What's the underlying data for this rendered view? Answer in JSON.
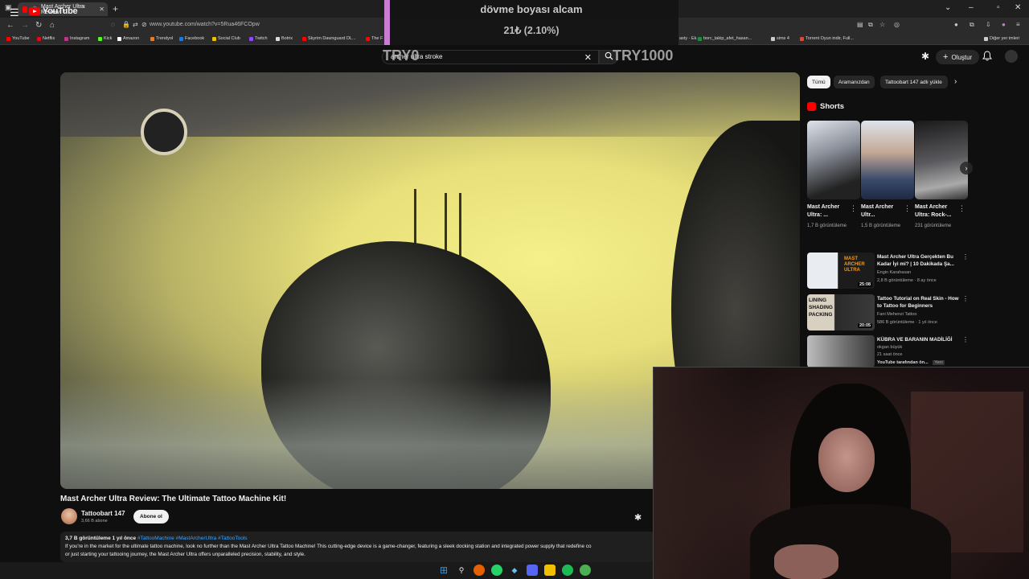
{
  "browser": {
    "tab_title": "Mast Archer Ultra Review: T",
    "url": "www.youtube.com/watch?v=5Rua46FCOpw",
    "bookmarks": [
      "YouTube",
      "Netflix",
      "Instagram",
      "Kick",
      "Amazon",
      "Trendyol",
      "Facebook",
      "Social Club",
      "Twitch",
      "Botrix",
      "Skyrim Dawnguard DL...",
      "The F"
    ],
    "bookmarks_right": [
      "asty - Ek...",
      "borc_takip_afet_hasan...",
      "sims 4",
      "Torrent Oyun indir, Full..."
    ],
    "other_bookmarks": "Diğer yer imleri"
  },
  "stream_overlay": {
    "title": "dövme boyası alcam",
    "progress": "21₺ (2.10%)",
    "goal_start": "TRY0",
    "goal_end": "TRY1000"
  },
  "youtube": {
    "logo": "YouTube",
    "logo_country": "TR",
    "search_value": "archer ultra stroke",
    "create_label": "Oluştur",
    "video_title": "Mast Archer Ultra Review: The Ultimate Tattoo Machine Kit!",
    "channel_name": "Tattoobart 147",
    "channel_subs": "3,66 B abone",
    "subscribe_label": "Abone ol",
    "desc_views": "3,7 B görüntüleme  1 yıl önce",
    "desc_tags": "#TattooMachine #MastArcherUltra #TattooTools",
    "desc_line1": "If you're in the market for the ultimate tattoo machine, look no further than the Mast Archer Ultra Tattoo Machine! This cutting-edge device is a game-changer, featuring a sleek docking station and integrated power supply that redefine co",
    "desc_line2": "or just starting your tattooing journey, the Mast Archer Ultra offers unparalleled precision, stability, and style."
  },
  "sidebar": {
    "chips": [
      "Tümü",
      "Aramanızdan",
      "Tattoobart 147 adlı yükle"
    ],
    "shorts_label": "Shorts",
    "shorts": [
      {
        "title": "Mast Archer Ultra: ...",
        "views": "1,7 B görüntüleme"
      },
      {
        "title": "Mast Archer Ultr...",
        "views": "1,5 B görüntüleme"
      },
      {
        "title": "Mast Archer Ultra: Rock-...",
        "views": "231 görüntüleme"
      }
    ],
    "recommended": [
      {
        "title": "Mast Archer Ultra Gerçekten Bu Kadar İyi mi? | 10 Dakikada Şa...",
        "channel": "Engin Karahasan",
        "meta": "2,8 B görüntüleme · 8 ay önce",
        "duration": "25:08",
        "thumb_text": "MAST ARCHER ULTRA"
      },
      {
        "title": "Tattoo Tutorial on Real Skin - How to Tattoo for Beginners",
        "channel": "Fani Mehenzi Tattoo",
        "meta": "586 B görüntüleme · 1 yıl önce",
        "duration": "20:05",
        "thumb_text": "LINING SHADING PACKING"
      },
      {
        "title": "KÜBRA VE BARANIN MADİLİĞİ",
        "channel": "okgan büyük",
        "meta": "21 saat önce",
        "extra": "YouTube tarafından ön...",
        "badge": "Yeni",
        "duration": ""
      }
    ]
  },
  "colors": {
    "yt_red": "#ff0000",
    "overlay_accent": "#c77dd0",
    "link_blue": "#3ea6ff"
  }
}
